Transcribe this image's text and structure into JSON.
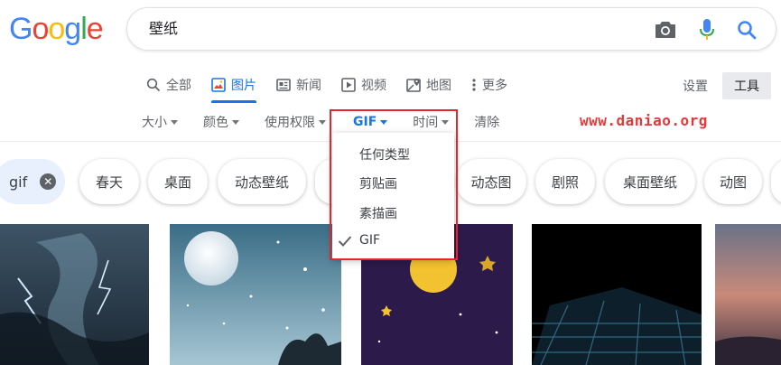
{
  "logo": {
    "letters": [
      "G",
      "o",
      "o",
      "g",
      "l",
      "e"
    ],
    "colors": [
      "#4285F4",
      "#EA4335",
      "#FBBC05",
      "#4285F4",
      "#34A853",
      "#EA4335"
    ]
  },
  "search": {
    "query": "壁纸"
  },
  "tabs": [
    {
      "label": "全部",
      "icon": "search-icon"
    },
    {
      "label": "图片",
      "icon": "image-icon",
      "active": true
    },
    {
      "label": "新闻",
      "icon": "news-icon"
    },
    {
      "label": "视频",
      "icon": "video-icon"
    },
    {
      "label": "地图",
      "icon": "map-icon"
    },
    {
      "label": "更多",
      "icon": "more-vert-icon"
    }
  ],
  "header_right": {
    "settings": "设置",
    "tools": "工具"
  },
  "filters": {
    "size": "大小",
    "color": "颜色",
    "rights": "使用权限",
    "type": "GIF",
    "time": "时间",
    "clear": "清除"
  },
  "watermark": "www.daniao.org",
  "chips": [
    "gif",
    "春天",
    "桌面",
    "动态壁纸",
    "动态图",
    "剧照",
    "桌面壁纸",
    "动图"
  ],
  "dropdown": {
    "items": [
      "任何类型",
      "剪贴画",
      "素描画",
      "GIF"
    ],
    "checked": "GIF"
  },
  "colors": {
    "accent": "#1a73e8",
    "highlight": "#e3262a",
    "watermark": "#e5383b"
  }
}
